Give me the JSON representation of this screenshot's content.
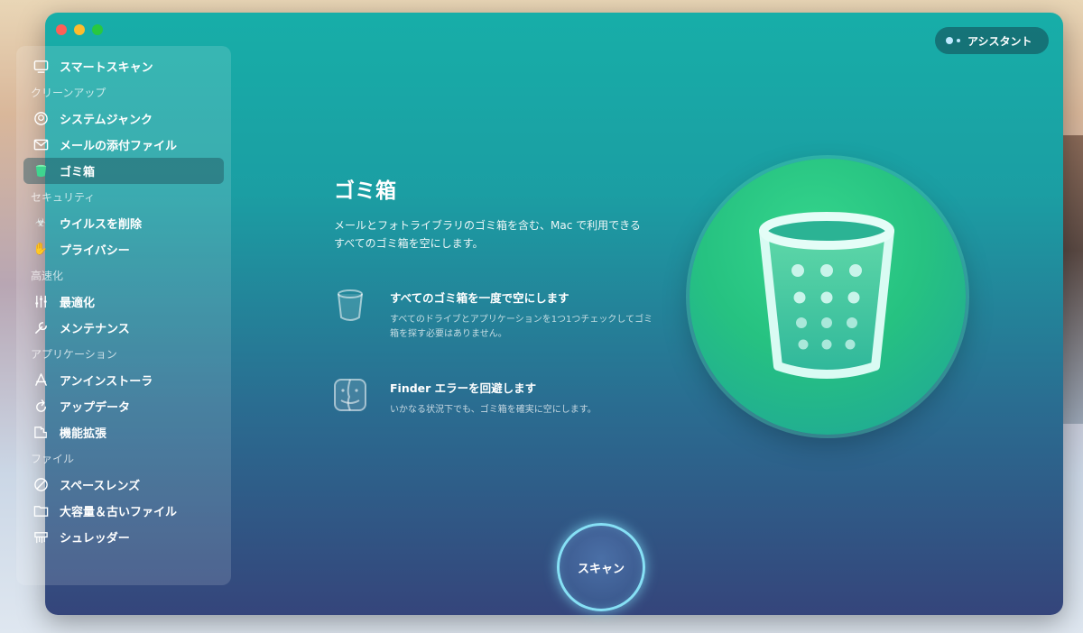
{
  "sidebar": {
    "top_item": {
      "label": "スマートスキャン",
      "icon": "smart-scan-icon"
    },
    "sections": [
      {
        "title": "クリーンアップ",
        "items": [
          {
            "label": "システムジャンク",
            "icon": "system-junk-icon"
          },
          {
            "label": "メールの添付ファイル",
            "icon": "mail-icon"
          },
          {
            "label": "ゴミ箱",
            "icon": "trash-icon",
            "active": true
          }
        ]
      },
      {
        "title": "セキュリティ",
        "items": [
          {
            "label": "ウイルスを削除",
            "icon": "biohazard-icon"
          },
          {
            "label": "プライバシー",
            "icon": "hand-icon"
          }
        ]
      },
      {
        "title": "高速化",
        "items": [
          {
            "label": "最適化",
            "icon": "sliders-icon"
          },
          {
            "label": "メンテナンス",
            "icon": "wrench-icon"
          }
        ]
      },
      {
        "title": "アプリケーション",
        "items": [
          {
            "label": "アンインストーラ",
            "icon": "app-uninstaller-icon"
          },
          {
            "label": "アップデータ",
            "icon": "updater-icon"
          },
          {
            "label": "機能拡張",
            "icon": "extensions-icon"
          }
        ]
      },
      {
        "title": "ファイル",
        "items": [
          {
            "label": "スペースレンズ",
            "icon": "space-lens-icon"
          },
          {
            "label": "大容量＆古いファイル",
            "icon": "folder-icon"
          },
          {
            "label": "シュレッダー",
            "icon": "shredder-icon"
          }
        ]
      }
    ]
  },
  "assistant": {
    "label": "アシスタント"
  },
  "main": {
    "title": "ゴミ箱",
    "description": "メールとフォトライブラリのゴミ箱を含む、Mac で利用できるすべてのゴミ箱を空にします。",
    "features": [
      {
        "title": "すべてのゴミ箱を一度で空にします",
        "description": "すべてのドライブとアプリケーションを1つ1つチェックしてゴミ箱を探す必要はありません。",
        "icon": "trash-outline-icon"
      },
      {
        "title": "Finder エラーを回避します",
        "description": "いかなる状況下でも、ゴミ箱を確実に空にします。",
        "icon": "finder-icon"
      }
    ]
  },
  "scan_button": {
    "label": "スキャン"
  },
  "colors": {
    "accent": "#1ea39a",
    "scan_ring": "#86e0f5",
    "circle_green": "#26c281"
  }
}
